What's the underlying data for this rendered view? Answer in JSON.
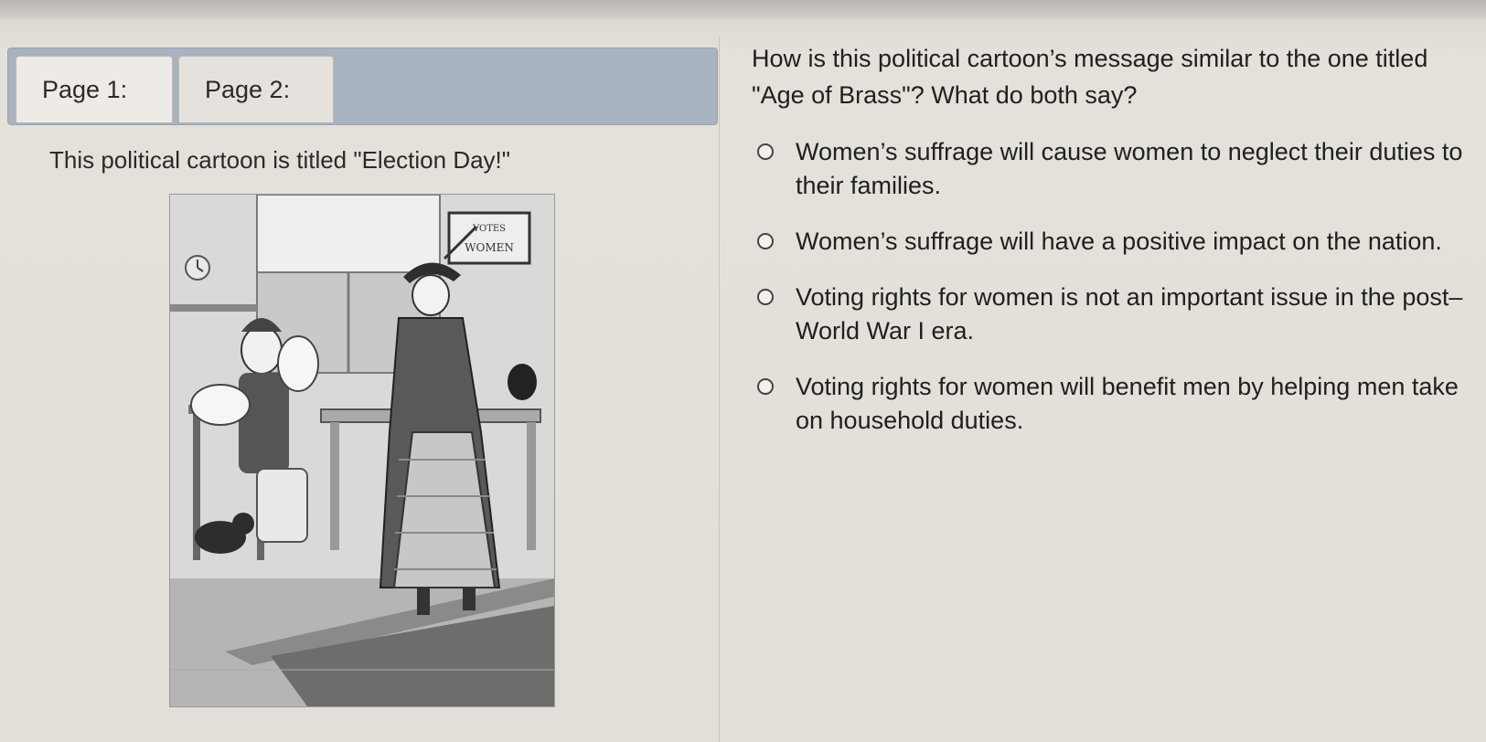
{
  "tabs": [
    {
      "label": "Page 1:"
    },
    {
      "label": "Page 2:"
    }
  ],
  "left": {
    "caption": "This political cartoon is titled \"Election Day!\"",
    "sign_text": "VOTES WOMEN"
  },
  "question": {
    "text": "How is this political cartoon’s message similar to the one titled \"Age of Brass\"? What do both say?"
  },
  "options": [
    {
      "label": "Women’s suffrage will cause women to neglect their duties to their families."
    },
    {
      "label": "Women’s suffrage will have a positive impact on the nation."
    },
    {
      "label": "Voting rights for women is not an important issue in the post–World War I era."
    },
    {
      "label": "Voting rights for women will benefit men by helping men take on household duties."
    }
  ]
}
